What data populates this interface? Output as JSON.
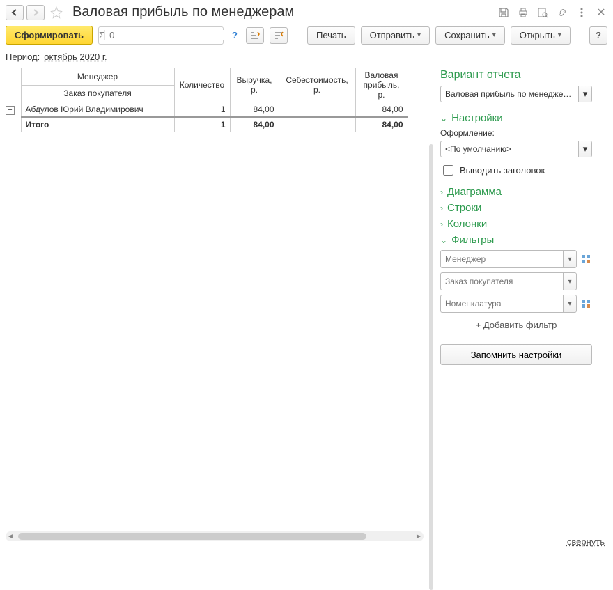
{
  "title": "Валовая прибыль по менеджерам",
  "toolbar": {
    "generate": "Сформировать",
    "sum_placeholder": "0",
    "print": "Печать",
    "send": "Отправить",
    "save": "Сохранить",
    "open": "Открыть",
    "help": "?"
  },
  "period": {
    "label": "Период:",
    "value": "октябрь 2020 г."
  },
  "table": {
    "headers": {
      "manager": "Менеджер",
      "order": "Заказ покупателя",
      "qty": "Количество",
      "revenue": "Выручка, р.",
      "cost": "Себестоимость, р.",
      "profit": "Валовая прибыль, р."
    },
    "rows": [
      {
        "name": "Абдулов Юрий Владимирович",
        "qty": "1",
        "revenue": "84,00",
        "cost": "",
        "profit": "84,00"
      }
    ],
    "total": {
      "label": "Итого",
      "qty": "1",
      "revenue": "84,00",
      "cost": "",
      "profit": "84,00"
    }
  },
  "right": {
    "variant_heading": "Вариант отчета",
    "variant_value": "Валовая прибыль по менеджерам",
    "settings": "Настройки",
    "design_label": "Оформление:",
    "design_value": "<По умолчанию>",
    "show_title": "Выводить заголовок",
    "diagram": "Диаграмма",
    "rows": "Строки",
    "columns": "Колонки",
    "filters": "Фильтры",
    "filter_items": [
      {
        "placeholder": "Менеджер",
        "has_icon": true
      },
      {
        "placeholder": "Заказ покупателя",
        "has_icon": false
      },
      {
        "placeholder": "Номенклатура",
        "has_icon": true
      }
    ],
    "add_filter": "+ Добавить фильтр",
    "remember": "Запомнить настройки"
  },
  "collapse": "свернуть"
}
